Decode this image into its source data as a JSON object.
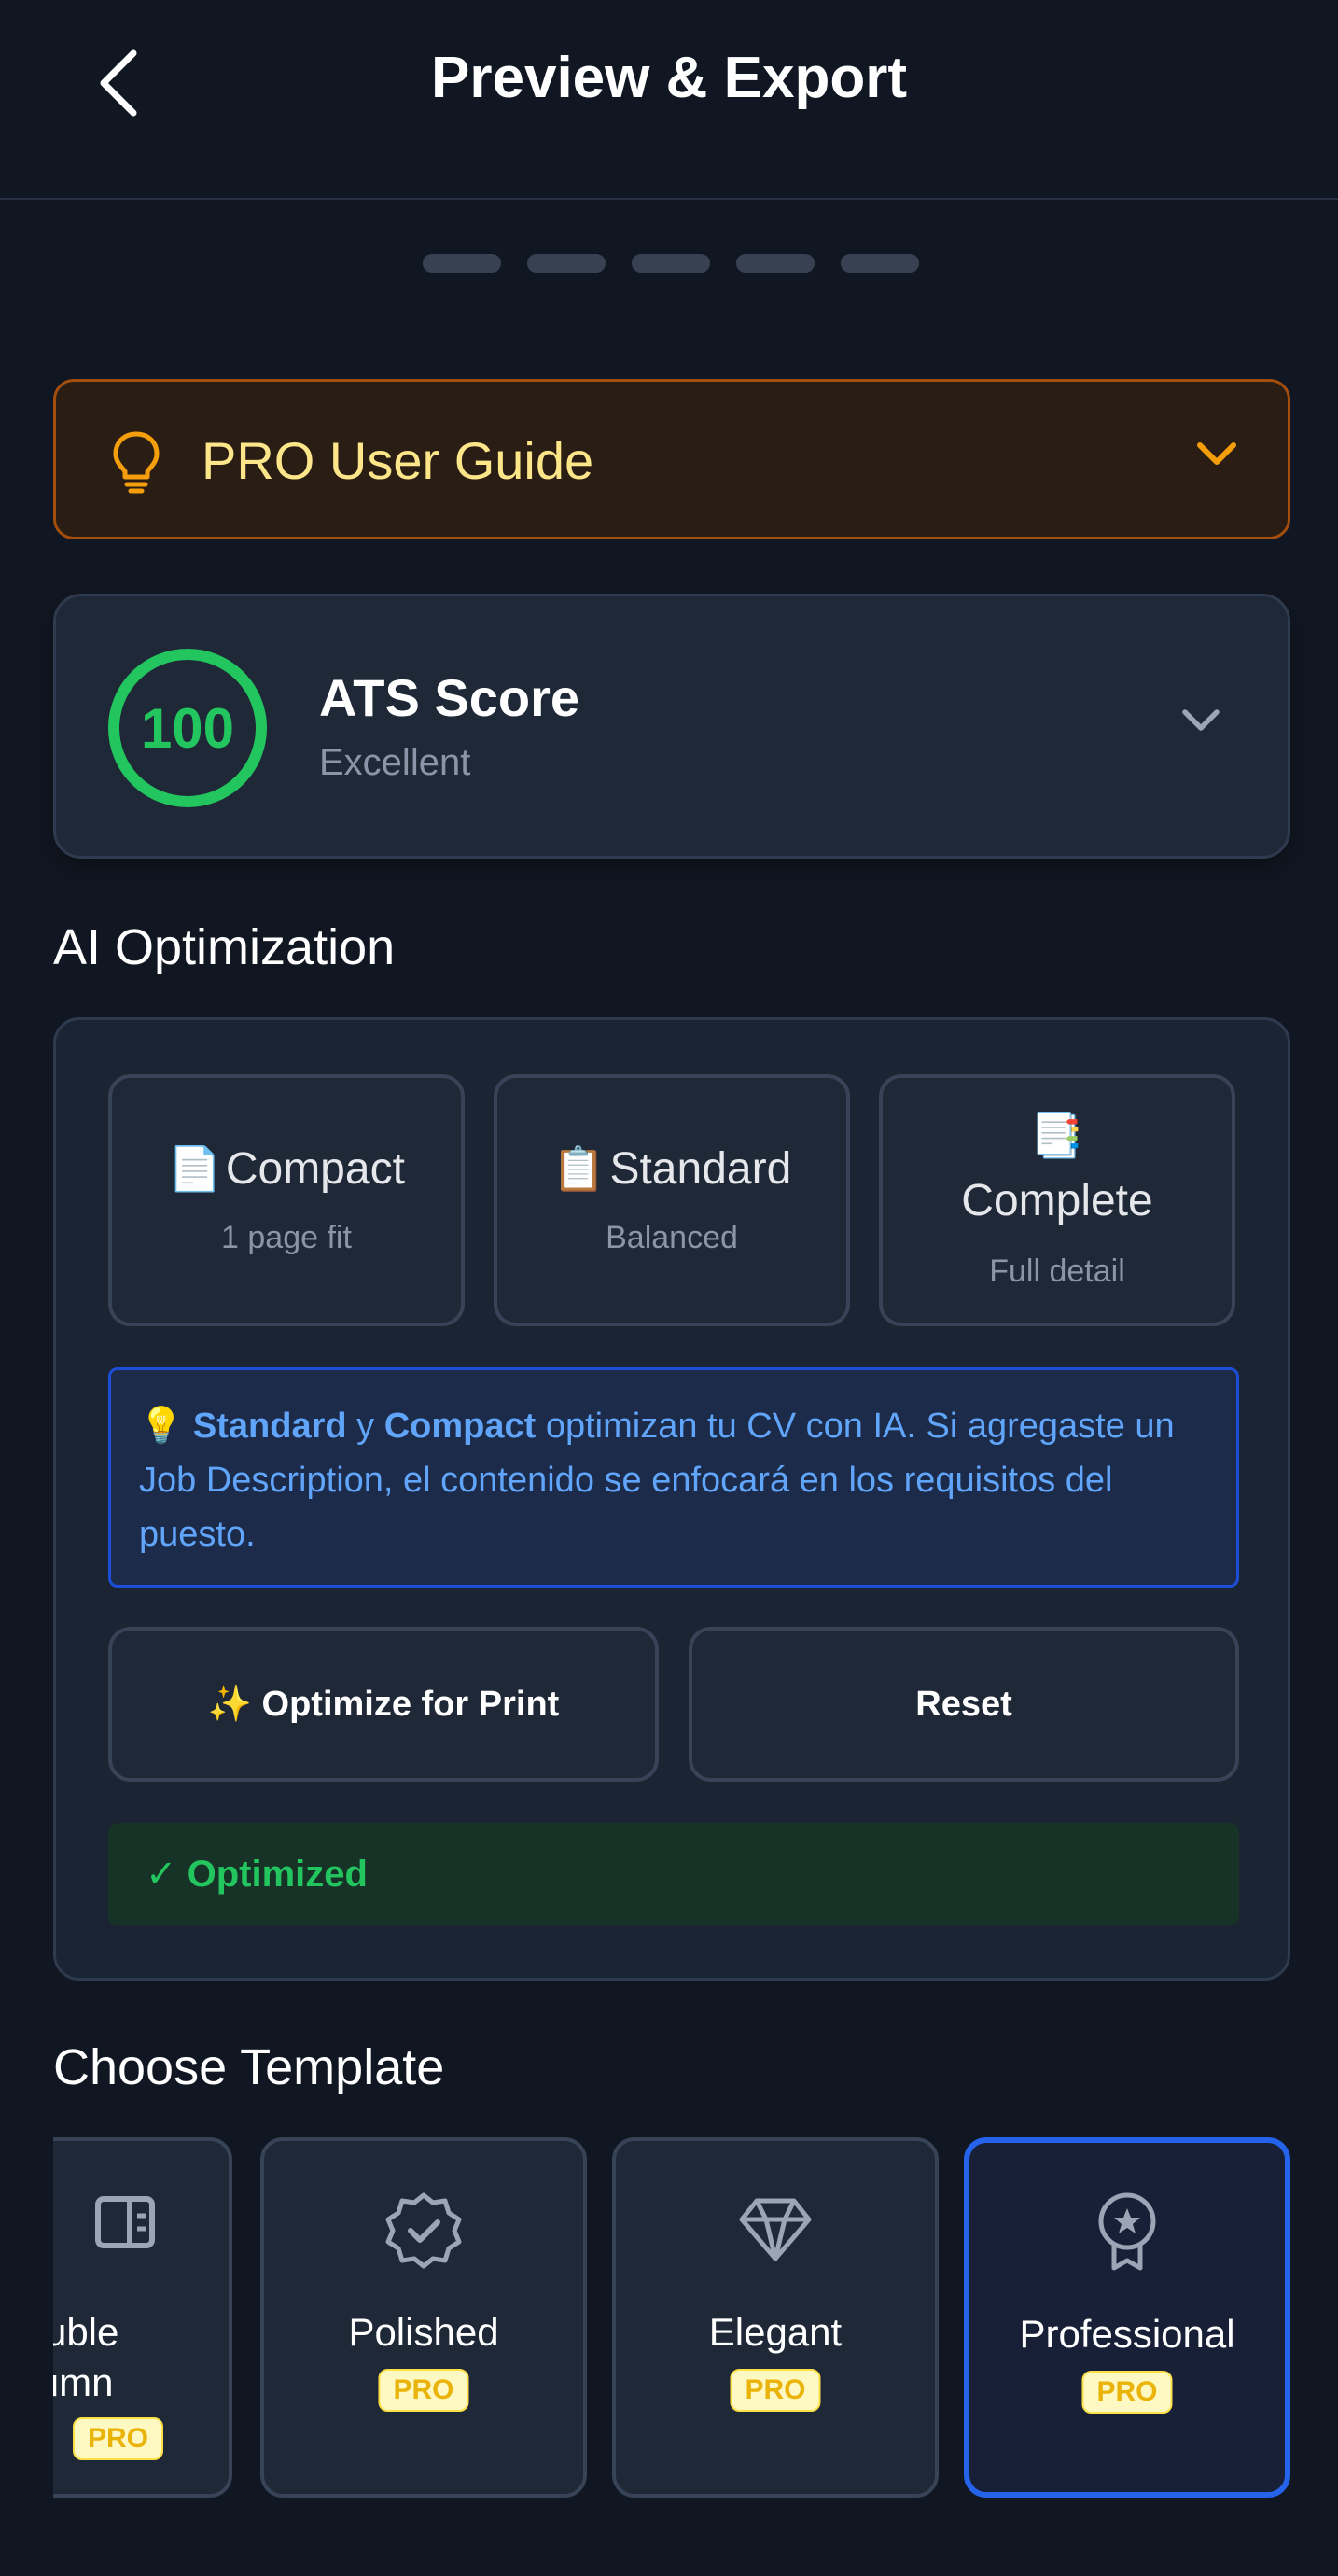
{
  "header": {
    "title": "Preview & Export",
    "back_icon": "chevron-left-icon"
  },
  "progress": {
    "total_steps": 5
  },
  "guide": {
    "label": "PRO User Guide",
    "icon": "lightbulb-icon",
    "accent": "#f59e0b"
  },
  "ats": {
    "score": "100",
    "title": "ATS Score",
    "rating": "Excellent",
    "score_color": "#22c55e"
  },
  "ai_optimization": {
    "title": "AI Optimization",
    "modes": [
      {
        "emoji": "📄",
        "name": "Compact",
        "desc": "1 page fit"
      },
      {
        "emoji": "📋",
        "name": "Standard",
        "desc": "Balanced"
      },
      {
        "emoji": "📑",
        "name": "Complete",
        "desc": "Full detail"
      }
    ],
    "note": {
      "emoji": "💡",
      "bold1": "Standard",
      "conj": " y ",
      "bold2": "Compact",
      "rest": " optimizan tu CV con IA. Si agregaste un Job Description, el contenido se enfocará en los requisitos del puesto."
    },
    "optimize_label": "✨ Optimize for Print",
    "reset_label": "Reset",
    "status": "✓ Optimized"
  },
  "templates": {
    "title": "Choose Template",
    "items": [
      {
        "name": "ouble\nlumn",
        "badge": "PRO",
        "icon": "columns-icon"
      },
      {
        "name": "Polished",
        "badge": "PRO",
        "icon": "badge-check-icon"
      },
      {
        "name": "Elegant",
        "badge": "PRO",
        "icon": "gem-icon"
      },
      {
        "name": "Professional",
        "badge": "PRO",
        "icon": "award-icon",
        "selected": true
      }
    ],
    "selected_color": "#2563eb"
  }
}
